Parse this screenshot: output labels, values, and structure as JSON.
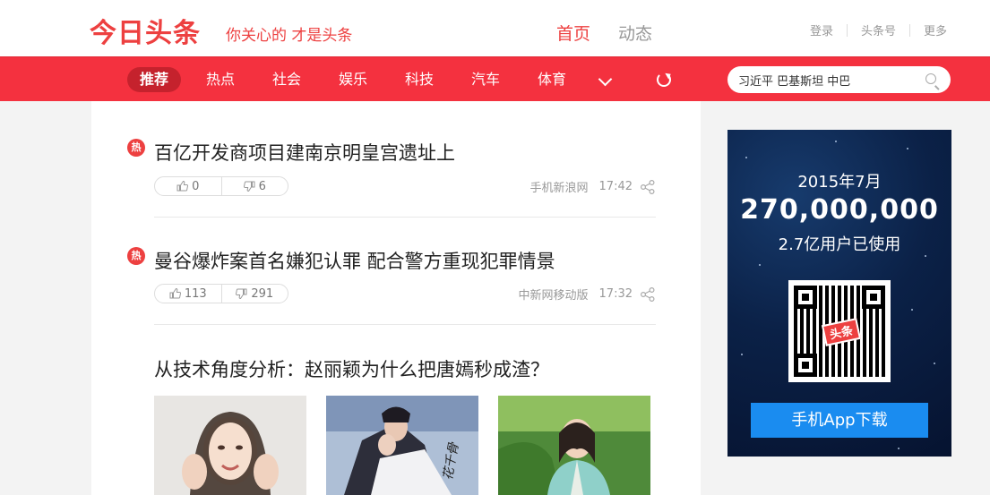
{
  "header": {
    "logo": "今日头条",
    "slogan": "你关心的 才是头条",
    "nav": [
      {
        "label": "首页",
        "active": true
      },
      {
        "label": "动态",
        "active": false
      }
    ],
    "links": [
      "登录",
      "头条号",
      "更多"
    ]
  },
  "channels": {
    "items": [
      "推荐",
      "热点",
      "社会",
      "娱乐",
      "科技",
      "汽车",
      "体育"
    ],
    "active_index": 0,
    "more_icon": "chevron-down-icon",
    "refresh_icon": "refresh-icon"
  },
  "search": {
    "value": "习近平 巴基斯坦 中巴",
    "icon": "search-icon"
  },
  "articles": [
    {
      "badge": "热",
      "title": "百亿开发商项目建南京明皇宫遗址上",
      "likes": "0",
      "dislikes": "6",
      "source": "手机新浪网",
      "time": "17:42"
    },
    {
      "badge": "热",
      "title": "曼谷爆炸案首名嫌犯认罪 配合警方重现犯罪情景",
      "likes": "113",
      "dislikes": "291",
      "source": "中新网移动版",
      "time": "17:32"
    },
    {
      "title": "从技术角度分析：赵丽颖为什么把唐嫣秒成渣？"
    }
  ],
  "ad": {
    "line1": "2015年7月",
    "number": "270,000,000",
    "line3": "2.7亿用户已使用",
    "qr_logo": "头条",
    "button": "手机App下载"
  },
  "colors": {
    "brand_red": "#ed4040",
    "channel_bar": "#f4313f",
    "download_blue": "#1a8cf0"
  }
}
